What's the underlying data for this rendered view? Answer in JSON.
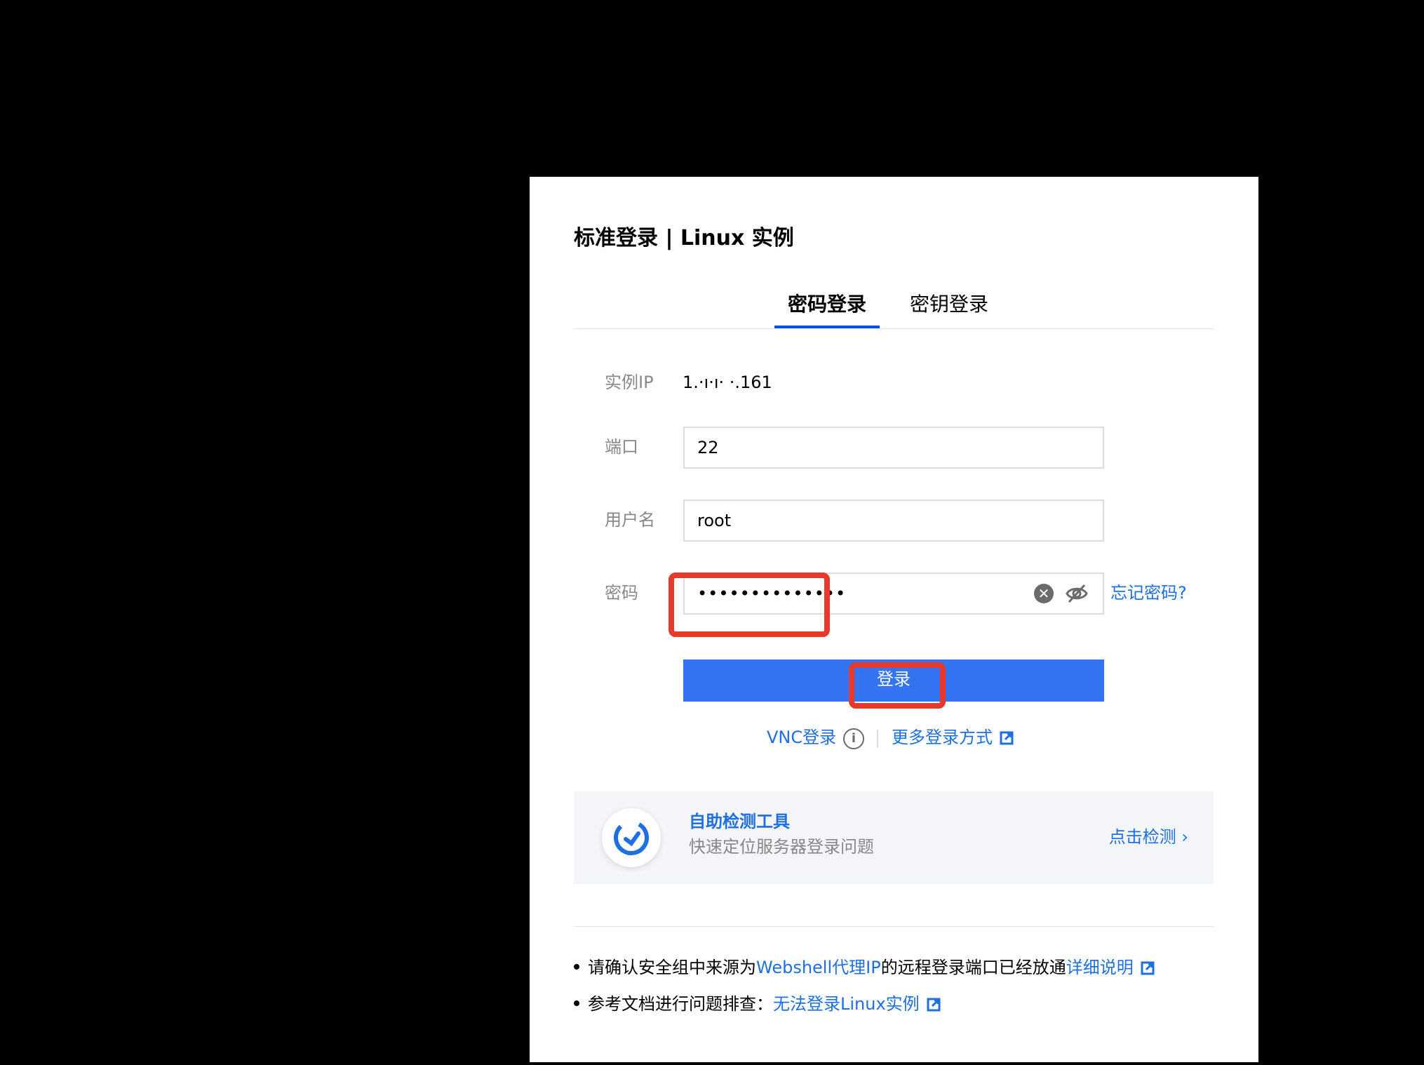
{
  "dialog": {
    "title": "标准登录 | Linux 实例",
    "tabs": [
      {
        "label": "密码登录",
        "active": true
      },
      {
        "label": "密钥登录",
        "active": false
      }
    ],
    "fields": {
      "ip_label": "实例IP",
      "ip_value": "1.·ı·ı·     ·.161",
      "port_label": "端口",
      "port_value": "22",
      "username_label": "用户名",
      "username_value": "root",
      "password_label": "密码",
      "password_value": "••••••••••••••",
      "forgot_password": "忘记密码?"
    },
    "login_button": "登录",
    "vnc_login": "VNC登录",
    "more_login": "更多登录方式",
    "tool": {
      "title": "自助检测工具",
      "subtitle": "快速定位服务器登录问题",
      "action": "点击检测 ›"
    },
    "notes": {
      "line1_pre": "请确认安全组中来源为",
      "line1_link": "Webshell代理IP",
      "line1_mid": "的远程登录端口已经放通",
      "line1_link2": "详细说明",
      "line2_pre": "参考文档进行问题排查：",
      "line2_link": "无法登录Linux实例"
    }
  },
  "colors": {
    "accent": "#3473f2",
    "link": "#1e6fe0",
    "highlight": "#e53a2c"
  }
}
